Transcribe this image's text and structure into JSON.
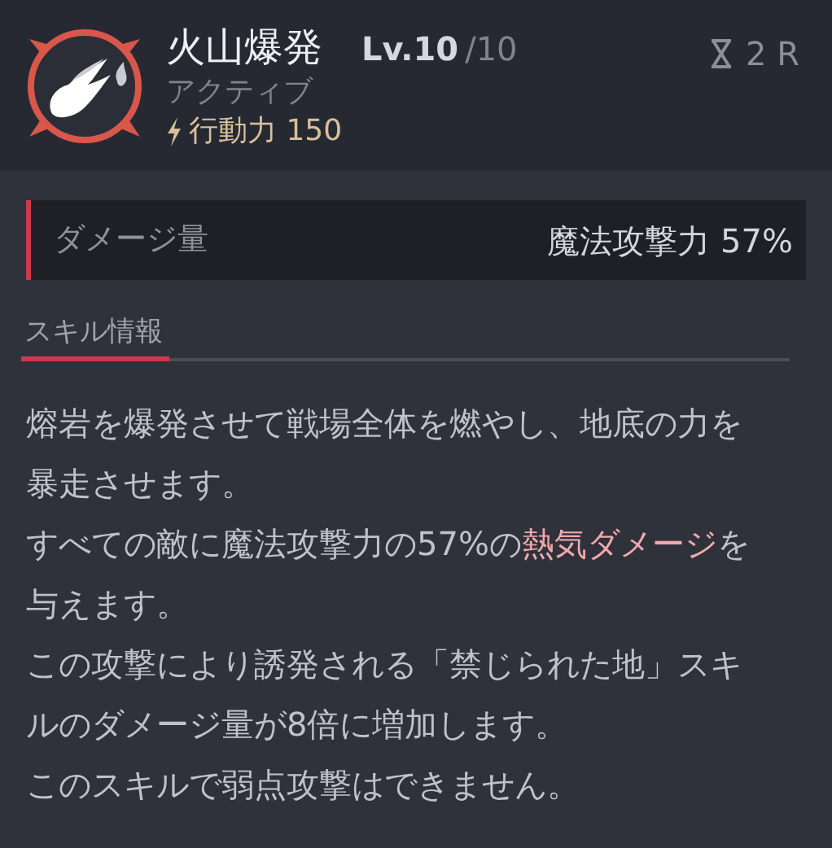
{
  "skill": {
    "name": "火山爆発",
    "level_label": "Lv.10",
    "level_max": "/10",
    "type": "アクティブ",
    "cost": "行動力 150",
    "cooldown": "2 R"
  },
  "damage": {
    "label": "ダメージ量",
    "value": "魔法攻撃力 57%"
  },
  "section_tab": "スキル情報",
  "description": [
    [
      {
        "text": "熔岩を爆発させて戦場全体を燃やし、地底の力を暴走させます。",
        "highlight": false
      }
    ],
    [
      {
        "text": "すべての敵に魔法攻撃力の57%の",
        "highlight": false
      },
      {
        "text": "熱気ダメージ",
        "highlight": true
      },
      {
        "text": "を与えます。",
        "highlight": false
      }
    ],
    [
      {
        "text": "この攻撃により誘発される「禁じられた地」スキルのダメージ量が8倍に増加します。",
        "highlight": false
      }
    ],
    [
      {
        "text": "このスキルで弱点攻撃はできません。",
        "highlight": false
      }
    ]
  ]
}
